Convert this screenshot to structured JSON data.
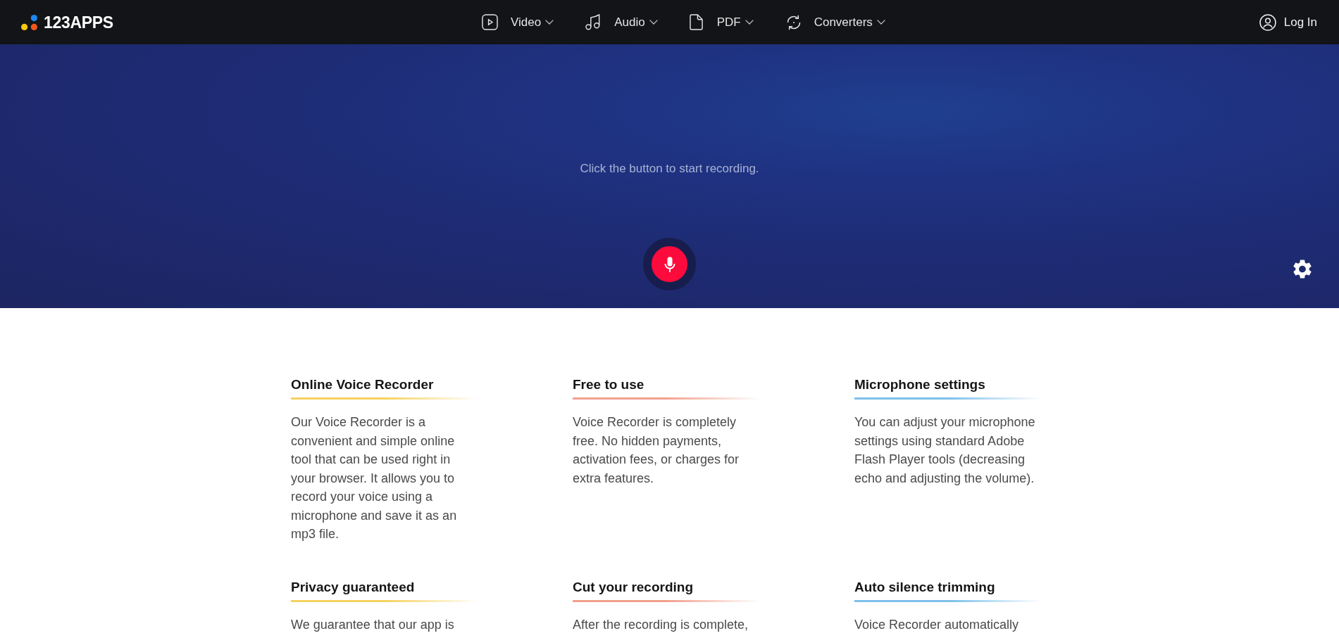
{
  "header": {
    "logo": "123APPS",
    "nav": [
      {
        "label": "Video"
      },
      {
        "label": "Audio"
      },
      {
        "label": "PDF"
      },
      {
        "label": "Converters"
      }
    ],
    "login": "Log In"
  },
  "recorder": {
    "prompt": "Click the button to start recording."
  },
  "features": [
    {
      "title": "Online Voice Recorder",
      "text": "Our Voice Recorder is a convenient and simple online tool that can be used right in your browser. It allows you to record your voice using a microphone and save it as an mp3 file.",
      "color": "#f6d25e"
    },
    {
      "title": "Free to use",
      "text": "Voice Recorder is completely free. No hidden payments, activation fees, or charges for extra features.",
      "color": "#f2a08e"
    },
    {
      "title": "Microphone settings",
      "text": "You can adjust your microphone settings using standard Adobe Flash Player tools (decreasing echo and adjusting the volume).",
      "color": "#7cc0ea"
    },
    {
      "title": "Privacy guaranteed",
      "text": "We guarantee that our app is",
      "color": "#f6d25e"
    },
    {
      "title": "Cut your recording",
      "text": "After the recording is complete,",
      "color": "#f2a08e"
    },
    {
      "title": "Auto silence trimming",
      "text": "Voice Recorder automatically",
      "color": "#7cc0ea"
    }
  ]
}
